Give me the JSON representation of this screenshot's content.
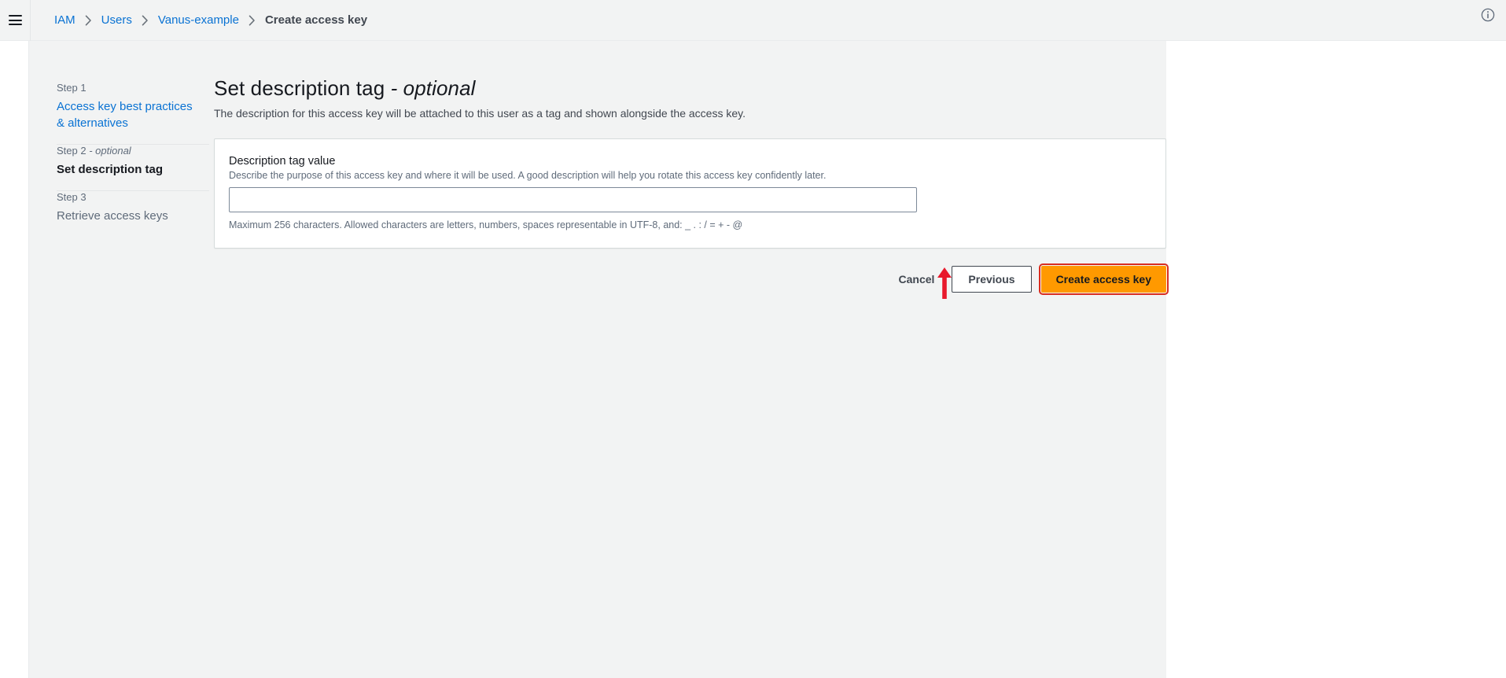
{
  "topbar": {
    "menu_icon": "hamburger-menu-icon",
    "info_icon": "info-circle-icon",
    "breadcrumb": [
      {
        "label": "IAM",
        "type": "link"
      },
      {
        "label": "Users",
        "type": "link"
      },
      {
        "label": "Vanus-example",
        "type": "link"
      },
      {
        "label": "Create access key",
        "type": "current"
      }
    ],
    "separator_icon": "chevron-right-icon"
  },
  "steps": [
    {
      "kicker": "Step 1",
      "optional_suffix": "",
      "title": "Access key best practices & alternatives",
      "state": "link"
    },
    {
      "kicker": "Step 2",
      "optional_suffix": "- optional",
      "title": "Set description tag",
      "state": "active"
    },
    {
      "kicker": "Step 3",
      "optional_suffix": "",
      "title": "Retrieve access keys",
      "state": "muted"
    }
  ],
  "main": {
    "title": "Set description tag",
    "title_optional": "- optional",
    "description": "The description for this access key will be attached to this user as a tag and shown alongside the access key.",
    "form": {
      "label": "Description tag value",
      "hint": "Describe the purpose of this access key and where it will be used. A good description will help you rotate this access key confidently later.",
      "input_value": "",
      "input_placeholder": "",
      "constraint": "Maximum 256 characters. Allowed characters are letters, numbers, spaces representable in UTF-8, and: _ . : / = + - @"
    },
    "actions": {
      "cancel_label": "Cancel",
      "previous_label": "Previous",
      "create_label": "Create access key"
    }
  },
  "annotation": {
    "arrow_color": "#e8192c",
    "highlight_color": "#d92d20",
    "target": "create-access-key-button"
  },
  "colors": {
    "accent_link": "#0972d3",
    "primary_button": "#ff9900",
    "page_background": "#f2f3f3",
    "card_background": "#ffffff",
    "text_primary": "#16191f",
    "text_secondary": "#5f6b7a"
  }
}
